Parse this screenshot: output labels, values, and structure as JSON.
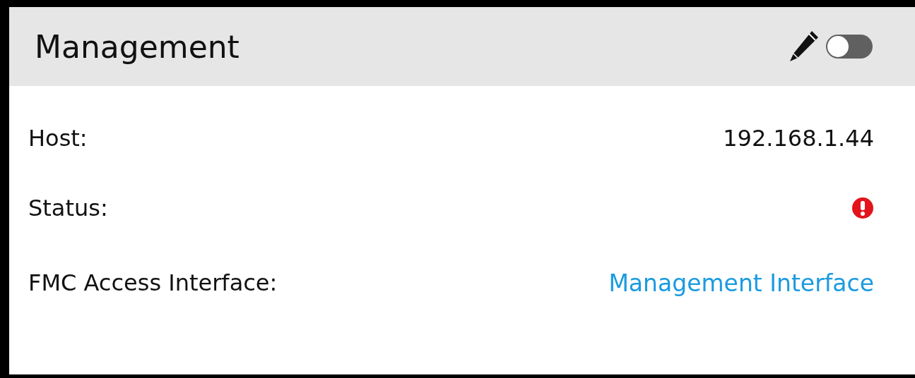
{
  "panel": {
    "title": "Management",
    "toggle": {
      "on": false
    }
  },
  "rows": [
    {
      "label": "Host:",
      "kind": "text",
      "value": "192.168.1.44"
    },
    {
      "label": "Status:",
      "kind": "error"
    },
    {
      "label": "FMC Access Interface:",
      "kind": "link",
      "value": "Management Interface"
    }
  ]
}
